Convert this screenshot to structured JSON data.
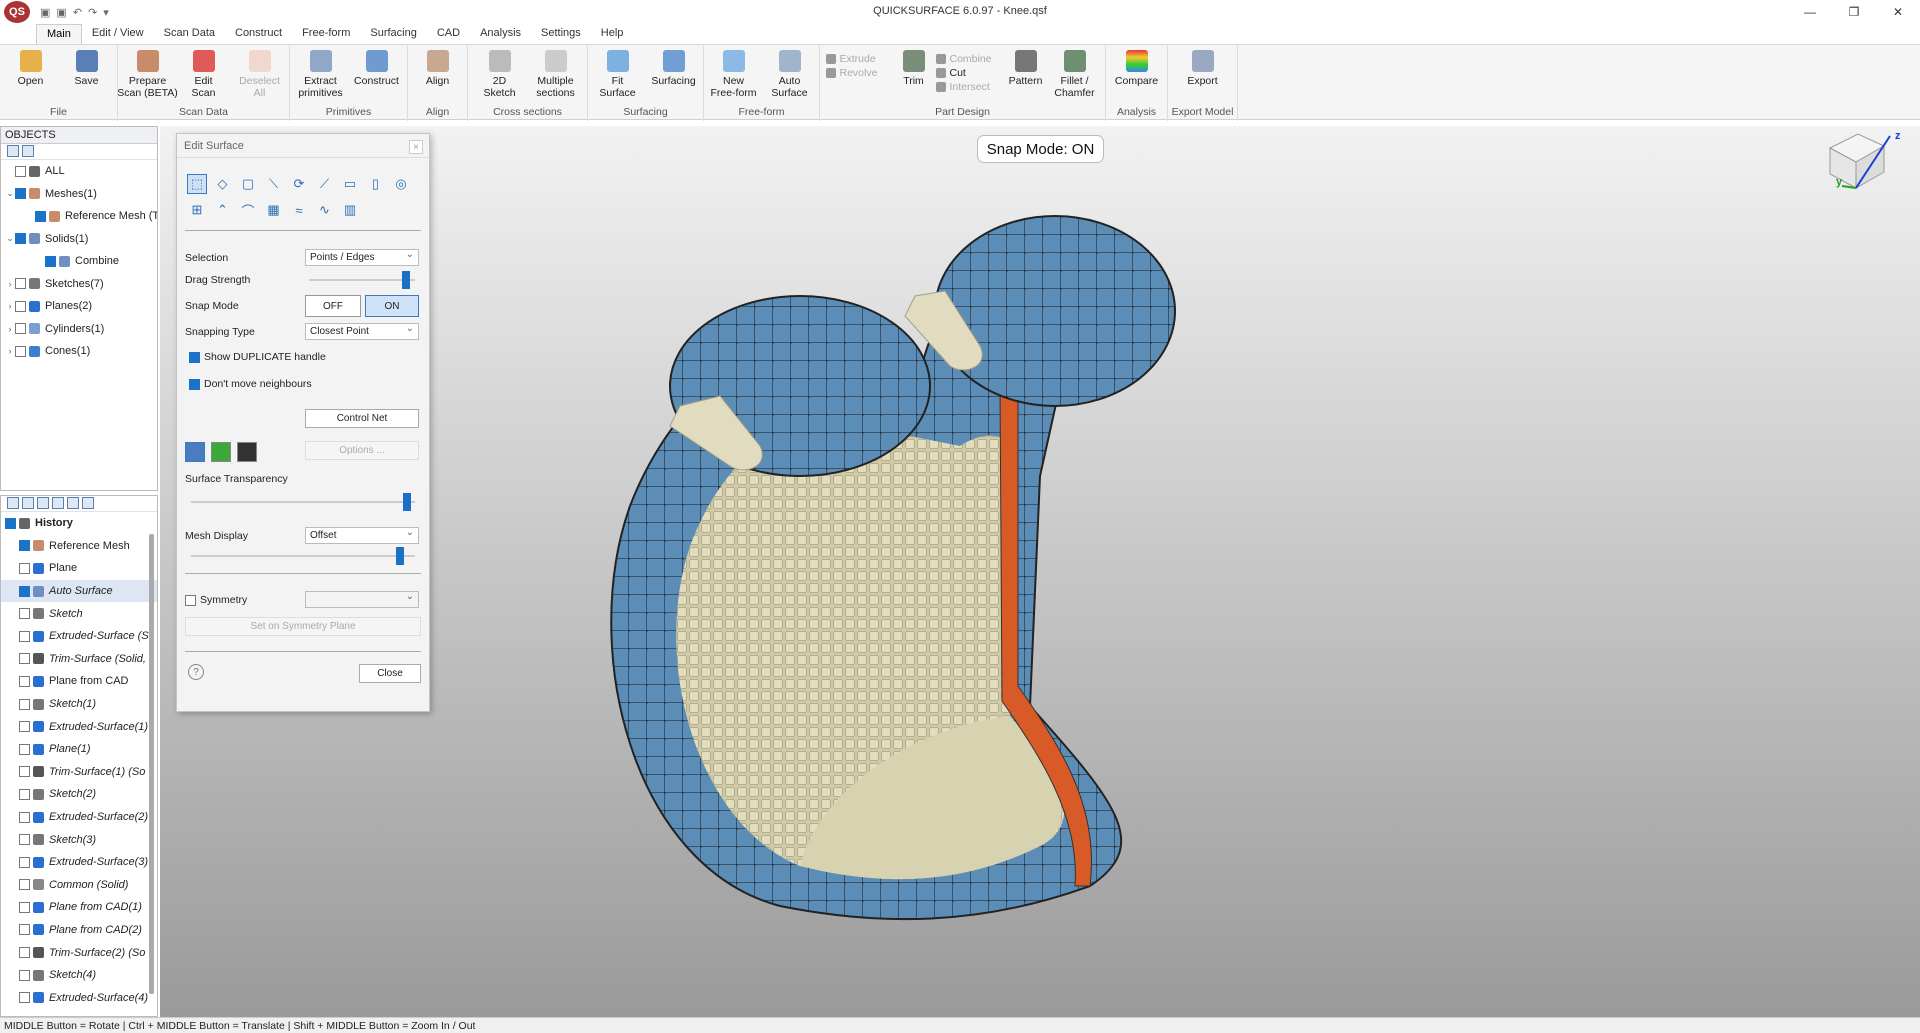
{
  "window": {
    "title": "QUICKSURFACE 6.0.97 - Knee.qsf",
    "logo": "QS",
    "controls": [
      "—",
      "❐",
      "✕"
    ]
  },
  "quick_access": [
    "▣",
    "▣",
    "↶",
    "↷",
    "▾"
  ],
  "menu": [
    "Main",
    "Edit / View",
    "Scan Data",
    "Construct",
    "Free-form",
    "Surfacing",
    "CAD",
    "Analysis",
    "Settings",
    "Help"
  ],
  "ribbon": {
    "file": {
      "label": "File",
      "open": "Open",
      "save": "Save"
    },
    "scan": {
      "label": "Scan Data",
      "prepare": "Prepare\nScan (BETA)",
      "edit": "Edit\nScan",
      "deselect": "Deselect\nAll"
    },
    "primitives": {
      "label": "Primitives",
      "extract": "Extract\nprimitives",
      "construct": "Construct"
    },
    "align": {
      "label": "Align",
      "align": "Align"
    },
    "cross": {
      "label": "Cross sections",
      "sketch": "2D\nSketch",
      "multiple": "Multiple\nsections"
    },
    "surfacing": {
      "label": "Surfacing",
      "fit": "Fit\nSurface",
      "surfacing": "Surfacing"
    },
    "freeform": {
      "label": "Free-form",
      "new": "New\nFree-form",
      "auto": "Auto\nSurface"
    },
    "part": {
      "label": "Part Design",
      "extrude": "Extrude",
      "revolve": "Revolve",
      "trim": "Trim",
      "combine": "Combine",
      "cut": "Cut",
      "intersect": "Intersect",
      "pattern": "Pattern",
      "fillet": "Fillet /\nChamfer"
    },
    "analysis": {
      "label": "Analysis",
      "compare": "Compare"
    },
    "export": {
      "label": "Export Model",
      "export": "Export"
    }
  },
  "objects": {
    "title": "OBJECTS",
    "items": [
      {
        "label": "ALL",
        "level": 0,
        "expand": "",
        "checked": false
      },
      {
        "label": "Meshes(1)",
        "level": 0,
        "expand": "⌄",
        "checked": true
      },
      {
        "label": "Reference Mesh (Ta",
        "level": 1,
        "expand": "",
        "checked": true
      },
      {
        "label": "Solids(1)",
        "level": 0,
        "expand": "⌄",
        "checked": true
      },
      {
        "label": "Combine",
        "level": 1,
        "expand": "",
        "checked": true
      },
      {
        "label": "Sketches(7)",
        "level": 0,
        "expand": "›",
        "checked": false
      },
      {
        "label": "Planes(2)",
        "level": 0,
        "expand": "›",
        "checked": false
      },
      {
        "label": "Cylinders(1)",
        "level": 0,
        "expand": "›",
        "checked": false
      },
      {
        "label": "Cones(1)",
        "level": 0,
        "expand": "›",
        "checked": false
      }
    ]
  },
  "history": {
    "title": "History",
    "items": [
      {
        "label": "Reference Mesh",
        "italic": false,
        "checked": true,
        "selected": false
      },
      {
        "label": "Plane",
        "italic": false,
        "checked": false,
        "selected": false
      },
      {
        "label": "Auto Surface",
        "italic": true,
        "checked": true,
        "selected": true
      },
      {
        "label": "Sketch",
        "italic": true,
        "checked": false,
        "selected": false
      },
      {
        "label": "Extruded-Surface (S",
        "italic": true,
        "checked": false,
        "selected": false
      },
      {
        "label": "Trim-Surface (Solid,",
        "italic": true,
        "checked": false,
        "selected": false
      },
      {
        "label": "Plane from CAD",
        "italic": false,
        "checked": false,
        "selected": false
      },
      {
        "label": "Sketch(1)",
        "italic": true,
        "checked": false,
        "selected": false
      },
      {
        "label": "Extruded-Surface(1)",
        "italic": true,
        "checked": false,
        "selected": false
      },
      {
        "label": "Plane(1)",
        "italic": true,
        "checked": false,
        "selected": false
      },
      {
        "label": "Trim-Surface(1) (So",
        "italic": true,
        "checked": false,
        "selected": false
      },
      {
        "label": "Sketch(2)",
        "italic": true,
        "checked": false,
        "selected": false
      },
      {
        "label": "Extruded-Surface(2)",
        "italic": true,
        "checked": false,
        "selected": false
      },
      {
        "label": "Sketch(3)",
        "italic": true,
        "checked": false,
        "selected": false
      },
      {
        "label": "Extruded-Surface(3)",
        "italic": true,
        "checked": false,
        "selected": false
      },
      {
        "label": "Common (Solid)",
        "italic": true,
        "checked": false,
        "selected": false
      },
      {
        "label": "Plane from CAD(1)",
        "italic": true,
        "checked": false,
        "selected": false
      },
      {
        "label": "Plane from CAD(2)",
        "italic": true,
        "checked": false,
        "selected": false
      },
      {
        "label": "Trim-Surface(2) (So",
        "italic": true,
        "checked": false,
        "selected": false
      },
      {
        "label": "Sketch(4)",
        "italic": true,
        "checked": false,
        "selected": false
      },
      {
        "label": "Extruded-Surface(4)",
        "italic": true,
        "checked": false,
        "selected": false
      }
    ]
  },
  "viewport": {
    "snap_badge": "Snap Mode: ON",
    "axis_y": "y",
    "axis_z": "z"
  },
  "dialog": {
    "title": "Edit Surface",
    "close_x": "×",
    "selection_label": "Selection",
    "selection_value": "Points / Edges",
    "drag_strength_label": "Drag Strength",
    "drag_strength": 0.95,
    "snap_mode_label": "Snap Mode",
    "snap_off": "OFF",
    "snap_on": "ON",
    "snapping_type_label": "Snapping Type",
    "snapping_type_value": "Closest Point",
    "show_duplicate": "Show DUPLICATE handle",
    "dont_move": "Don't move neighbours",
    "control_net": "Control Net",
    "options": "Options ...",
    "transparency_label": "Surface Transparency",
    "transparency": 0.98,
    "mesh_display_label": "Mesh Display",
    "mesh_display_value": "Offset",
    "mesh_offset": 0.95,
    "symmetry_label": "Symmetry",
    "set_symmetry": "Set on Symmetry Plane",
    "help": "?",
    "close": "Close"
  },
  "status": "MIDDLE Button = Rotate | Ctrl + MIDDLE Button = Translate | Shift + MIDDLE Button = Zoom In / Out",
  "colors": {
    "blue_surface": "#5b8db6",
    "mesh_bone": "#d7d2b0",
    "orange_edge": "#d85a26"
  }
}
